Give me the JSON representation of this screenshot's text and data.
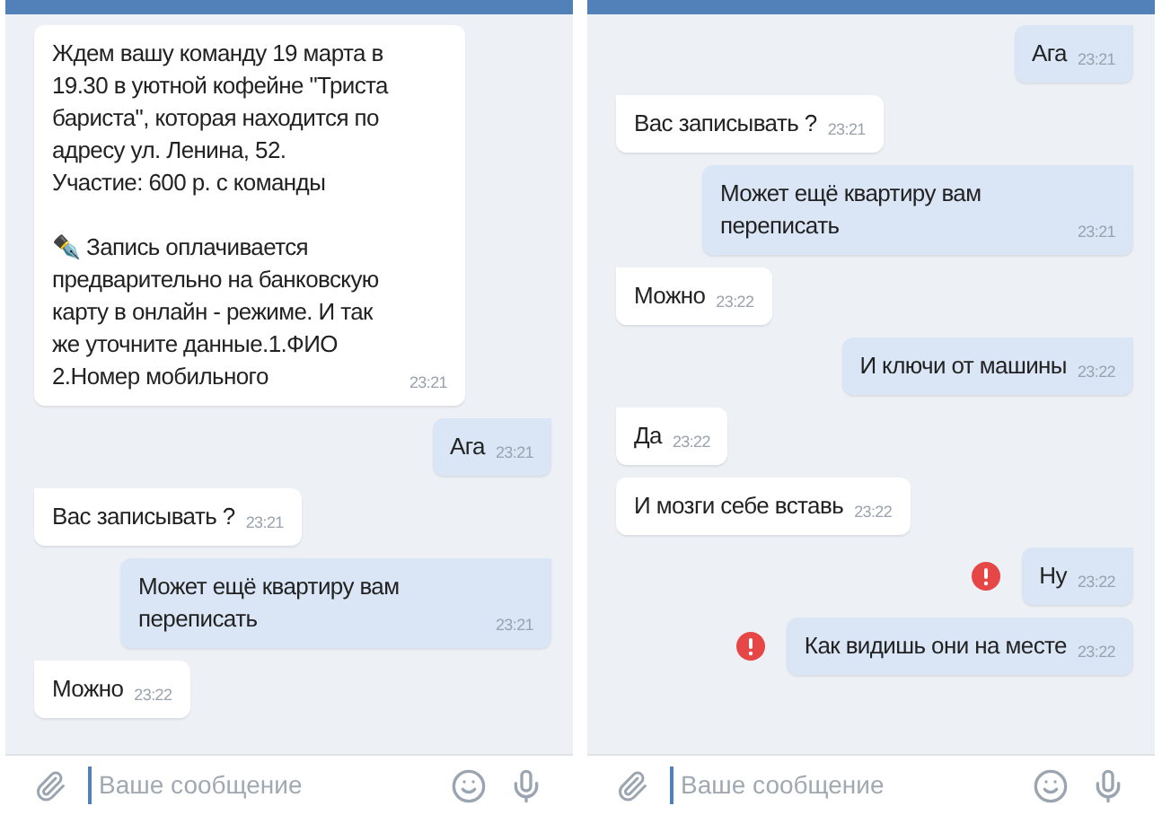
{
  "panels": [
    {
      "messages": [
        {
          "kind": "in",
          "error": false,
          "text": "Ждем вашу команду 19 марта в 19.30 в уютной кофейне \"Триста бариста\", которая находится по адресу ул. Ленина, 52.\nУчастие: 600 р. с команды\n\n✒️ Запись оплачивается предварительно на банковскую карту в онлайн - режиме. И так же уточните данные.1.ФИО 2.Номер мобильного",
          "time": "23:21"
        },
        {
          "kind": "out",
          "tail": true,
          "error": false,
          "text": "Ага",
          "time": "23:21"
        },
        {
          "kind": "in",
          "tail": true,
          "error": false,
          "text": "Вас записывать ?",
          "time": "23:21"
        },
        {
          "kind": "out",
          "tail": true,
          "error": false,
          "text": "Может ещё квартиру вам переписать",
          "time": "23:21"
        },
        {
          "kind": "in",
          "tail": true,
          "error": false,
          "text": "Можно",
          "time": "23:22"
        }
      ],
      "composer": {
        "placeholder": "Ваше сообщение"
      }
    },
    {
      "messages": [
        {
          "kind": "out",
          "tail": true,
          "error": false,
          "text": "Ага",
          "time": "23:21"
        },
        {
          "kind": "in",
          "tail": true,
          "error": false,
          "text": "Вас записывать ?",
          "time": "23:21"
        },
        {
          "kind": "out",
          "tail": true,
          "error": false,
          "text": "Может ещё квартиру вам переписать",
          "time": "23:21"
        },
        {
          "kind": "in",
          "tail": true,
          "error": false,
          "text": "Можно",
          "time": "23:22"
        },
        {
          "kind": "out",
          "tail": true,
          "error": false,
          "text": "И ключи от машины",
          "time": "23:22"
        },
        {
          "kind": "in",
          "tail": true,
          "error": false,
          "text": "Да",
          "time": "23:22"
        },
        {
          "kind": "in",
          "tail": false,
          "error": false,
          "text": "И мозги себе вставь",
          "time": "23:22"
        },
        {
          "kind": "out",
          "tail": true,
          "error": true,
          "text": "Ну",
          "time": "23:22"
        },
        {
          "kind": "out",
          "tail": false,
          "error": true,
          "text": "Как видишь они на месте",
          "time": "23:22"
        }
      ],
      "composer": {
        "placeholder": "Ваше сообщение"
      }
    }
  ]
}
